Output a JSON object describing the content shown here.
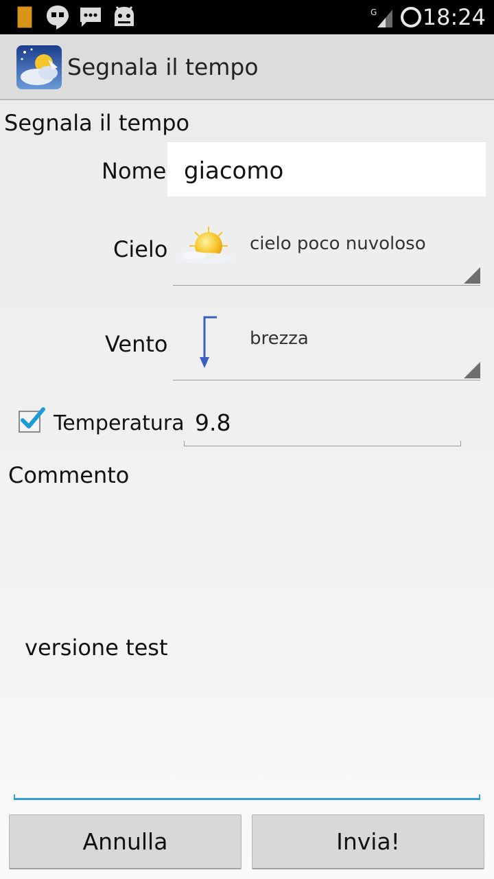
{
  "status_bar": {
    "time": "18:24",
    "icons": [
      "battery-icon",
      "hangouts-icon",
      "chat-icon",
      "android-debug-icon",
      "signal-icon",
      "sync-icon"
    ],
    "network_type": "G"
  },
  "action_bar": {
    "title": "Segnala il tempo",
    "icon": "weather-app-icon"
  },
  "form": {
    "title": "Segnala il tempo",
    "name": {
      "label": "Nome",
      "value": "giacomo"
    },
    "sky": {
      "label": "Cielo",
      "selected": "cielo poco nuvoloso",
      "icon": "partly-cloudy-icon"
    },
    "wind": {
      "label": "Vento",
      "selected": "brezza",
      "icon": "wind-arrow-icon"
    },
    "temperature": {
      "label": "Temperatura",
      "checked": true,
      "value": "9.8"
    },
    "comment": {
      "label": "Commento",
      "value": "versione test"
    }
  },
  "buttons": {
    "cancel": "Annulla",
    "send": "Invia!"
  },
  "colors": {
    "focus_accent": "#33a0d0",
    "checkmark": "#1e9bd7",
    "wind_arrow": "#3a5fc0"
  }
}
